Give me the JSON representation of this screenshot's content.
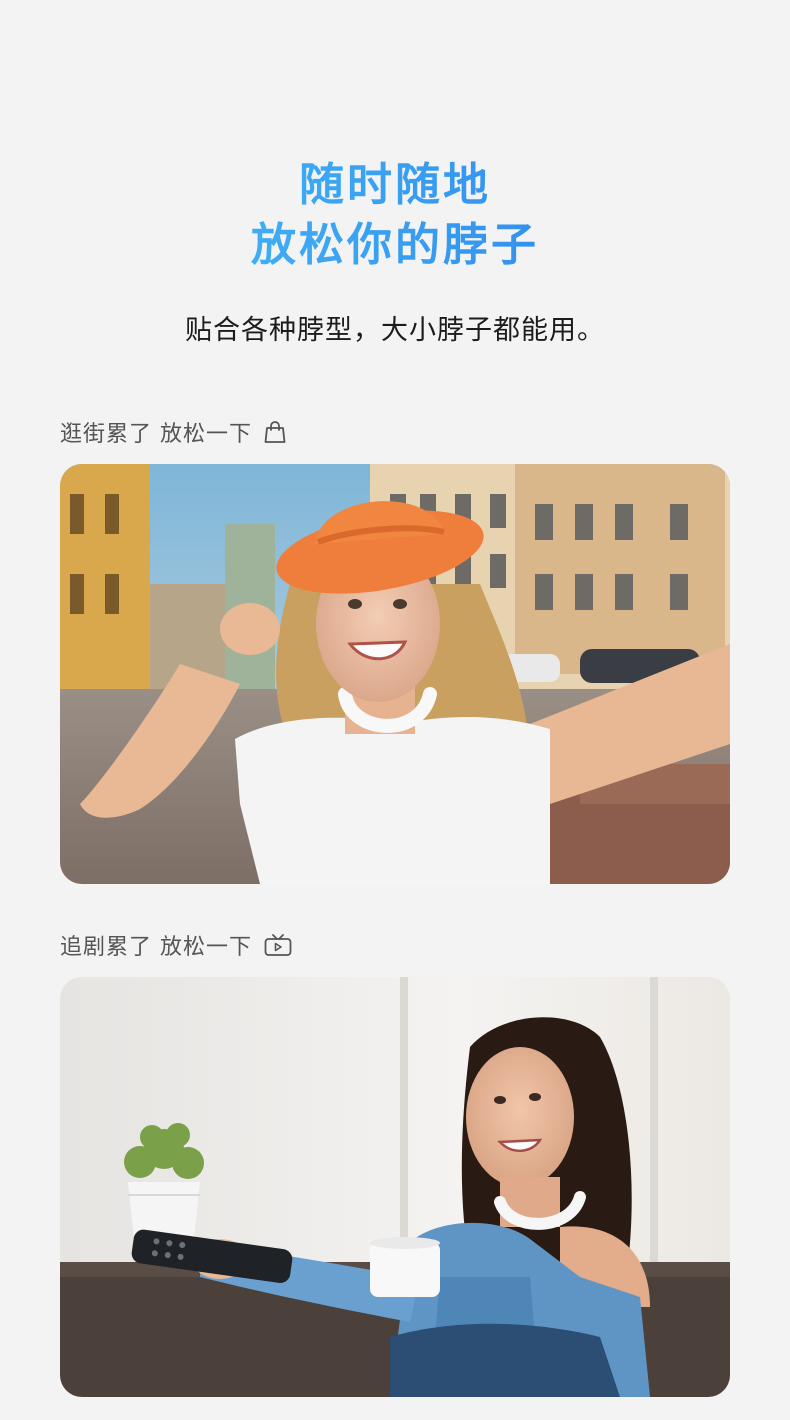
{
  "headline": {
    "line1": "随时随地",
    "line2": "放松你的脖子",
    "gradient": [
      "#4cc6f7",
      "#3aa3f2",
      "#2a78ea"
    ]
  },
  "subtitle": "贴合各种脖型，大小脖子都能用。",
  "sections": [
    {
      "label": "逛街累了 放松一下",
      "icon": "shopping-bag-icon"
    },
    {
      "label": "追剧累了 放松一下",
      "icon": "tv-icon"
    }
  ]
}
